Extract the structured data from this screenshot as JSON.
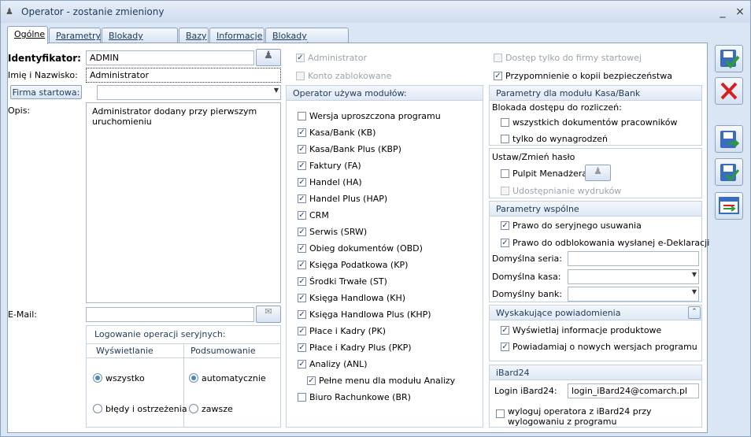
{
  "window": {
    "title": "Operator - zostanie zmieniony",
    "minimize": "_",
    "close": "×"
  },
  "tabs": [
    "Ogólne",
    "Parametry",
    "Blokady dostępu",
    "Bazy",
    "Informacje",
    "Blokady atrybutów"
  ],
  "left": {
    "identyfikator_label": "Identyfikator:",
    "identyfikator_value": "ADMIN",
    "imie_label": "Imię i Nazwisko:",
    "imie_value": "Administrator",
    "firma_button": "Firma startowa:",
    "firma_value": "",
    "opis_label": "Opis:",
    "opis_value": "Administrator dodany przy pierwszym uruchomieniu",
    "email_label": "E-Mail:",
    "email_value": "",
    "logowanie_title": "Logowanie operacji seryjnych:",
    "wyswietlanie_head": "Wyświetlanie",
    "podsumowanie_head": "Podsumowanie",
    "radio_wszystko": "wszystko",
    "radio_bledy": "błędy i ostrzeżenia",
    "radio_auto": "automatycznie",
    "radio_zawsze": "zawsze"
  },
  "middle": {
    "administrator": "Administrator",
    "konto_zablokowane": "Konto zablokowane",
    "modules_title": "Operator używa modułów:",
    "modules": [
      {
        "label": "Wersja uproszczona programu",
        "checked": false
      },
      {
        "label": "Kasa/Bank (KB)",
        "checked": true
      },
      {
        "label": "Kasa/Bank Plus (KBP)",
        "checked": true
      },
      {
        "label": "Faktury (FA)",
        "checked": true
      },
      {
        "label": "Handel (HA)",
        "checked": true
      },
      {
        "label": "Handel Plus (HAP)",
        "checked": true
      },
      {
        "label": "CRM",
        "checked": true
      },
      {
        "label": "Serwis (SRW)",
        "checked": true
      },
      {
        "label": "Obieg dokumentów (OBD)",
        "checked": true
      },
      {
        "label": "Księga Podatkowa (KP)",
        "checked": true
      },
      {
        "label": "Środki Trwałe (ST)",
        "checked": true
      },
      {
        "label": "Księga Handlowa (KH)",
        "checked": true
      },
      {
        "label": "Księga Handlowa Plus (KHP)",
        "checked": true
      },
      {
        "label": "Płace i Kadry (PK)",
        "checked": true
      },
      {
        "label": "Płace i Kadry Plus (PKP)",
        "checked": true
      },
      {
        "label": "Analizy (ANL)",
        "checked": true
      },
      {
        "label": "Pełne menu dla modułu Analizy",
        "checked": true,
        "indent": true
      },
      {
        "label": "Biuro Rachunkowe (BR)",
        "checked": false
      }
    ]
  },
  "right": {
    "dostep_firma": "Dostęp tylko do firmy startowej",
    "przypomnienie": "Przypomnienie o kopii bezpieczeństwa",
    "kasabank_title": "Parametry dla modułu Kasa/Bank",
    "blokada_label": "Blokada dostępu do rozliczeń:",
    "wszystkich_dok": "wszystkich dokumentów pracowników",
    "tylko_wynagr": "tylko do wynagrodzeń",
    "haslo_title": "Ustaw/Zmień hasło",
    "pulpit": "Pulpit Menadżera",
    "udostepnianie": "Udostępnianie wydruków",
    "wspolne_title": "Parametry wspólne",
    "prawo_usuwania": "Prawo do seryjnego usuwania",
    "prawo_odblok": "Prawo do odblokowania wysłanej e-Deklaracji",
    "seria_label": "Domyślna seria:",
    "seria_value": "",
    "kasa_label": "Domyślna kasa:",
    "kasa_value": "",
    "bank_label": "Domyślny bank:",
    "bank_value": "",
    "powiad_title": "Wyskakujące powiadomienia",
    "info_prod": "Wyświetlaj informacje produktowe",
    "nowe_wersje": "Powiadamiaj o nowych wersjach programu",
    "ibard_title": "iBard24",
    "login_label": "Login iBard24:",
    "login_value": "login_iBard24@comarch.pl",
    "wyloguj": "wyloguj operatora z iBard24 przy wylogowaniu z programu"
  },
  "colors": {
    "accent": "#1e395b",
    "checkmark": "#2b3f5c",
    "radio": "#3d8ad0",
    "save_green": "#2e9a3a",
    "cancel_red": "#d62020"
  }
}
